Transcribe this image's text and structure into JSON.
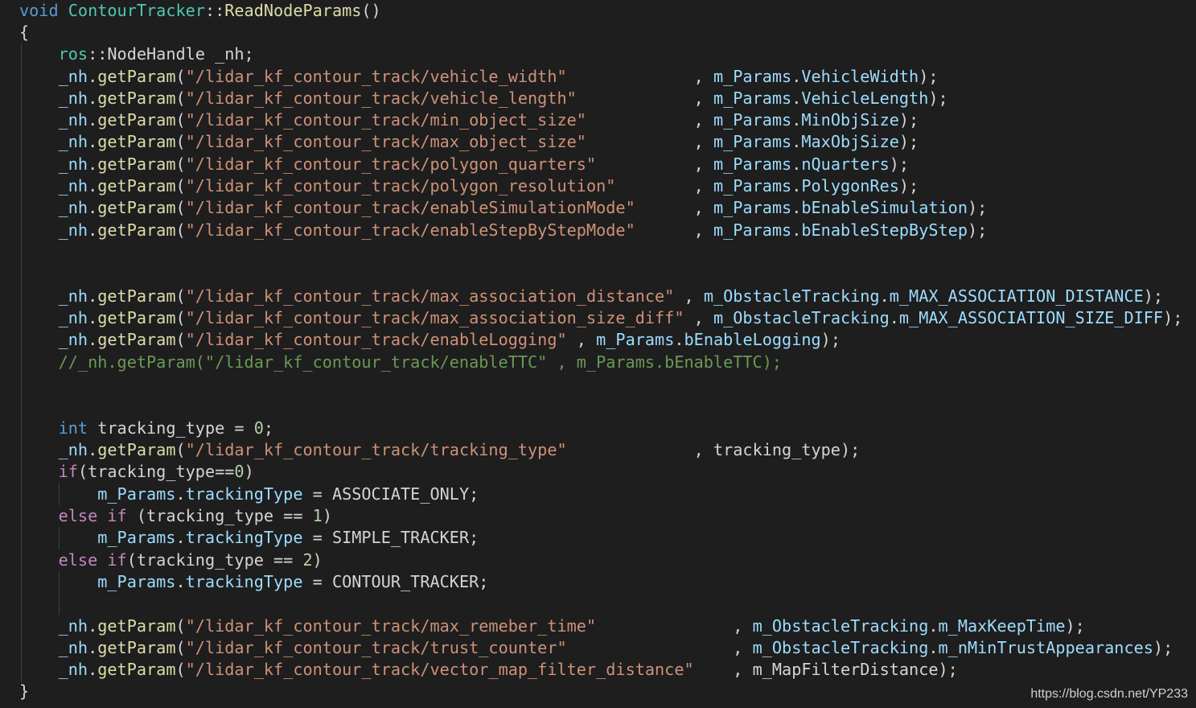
{
  "editor": {
    "theme_colors": {
      "background": "#1e1e1e",
      "keyword": "#569cd6",
      "control": "#c586c0",
      "type": "#4ec9b0",
      "function": "#dcdcaa",
      "string": "#ce9178",
      "variable": "#9cdcfe",
      "number": "#b5cea8",
      "comment": "#6a9955",
      "plain": "#d4d4d4"
    },
    "lines": [
      [
        [
          "kw",
          "void"
        ],
        [
          "plain",
          " "
        ],
        [
          "type",
          "ContourTracker"
        ],
        [
          "plain",
          "::"
        ],
        [
          "fn",
          "ReadNodeParams"
        ],
        [
          "plain",
          "()"
        ]
      ],
      [
        [
          "plain",
          "{"
        ]
      ],
      [
        [
          "plain",
          "    "
        ],
        [
          "type",
          "ros"
        ],
        [
          "plain",
          "::NodeHandle _nh;"
        ]
      ],
      [
        [
          "plain",
          "    "
        ],
        [
          "var",
          "_nh"
        ],
        [
          "plain",
          "."
        ],
        [
          "fn",
          "getParam"
        ],
        [
          "plain",
          "("
        ],
        [
          "str",
          "\"/lidar_kf_contour_track/vehicle_width\""
        ],
        [
          "plain",
          "             , "
        ],
        [
          "var",
          "m_Params"
        ],
        [
          "plain",
          "."
        ],
        [
          "var",
          "VehicleWidth"
        ],
        [
          "plain",
          ");"
        ]
      ],
      [
        [
          "plain",
          "    "
        ],
        [
          "var",
          "_nh"
        ],
        [
          "plain",
          "."
        ],
        [
          "fn",
          "getParam"
        ],
        [
          "plain",
          "("
        ],
        [
          "str",
          "\"/lidar_kf_contour_track/vehicle_length\""
        ],
        [
          "plain",
          "            , "
        ],
        [
          "var",
          "m_Params"
        ],
        [
          "plain",
          "."
        ],
        [
          "var",
          "VehicleLength"
        ],
        [
          "plain",
          ");"
        ]
      ],
      [
        [
          "plain",
          "    "
        ],
        [
          "var",
          "_nh"
        ],
        [
          "plain",
          "."
        ],
        [
          "fn",
          "getParam"
        ],
        [
          "plain",
          "("
        ],
        [
          "str",
          "\"/lidar_kf_contour_track/min_object_size\""
        ],
        [
          "plain",
          "           , "
        ],
        [
          "var",
          "m_Params"
        ],
        [
          "plain",
          "."
        ],
        [
          "var",
          "MinObjSize"
        ],
        [
          "plain",
          ");"
        ]
      ],
      [
        [
          "plain",
          "    "
        ],
        [
          "var",
          "_nh"
        ],
        [
          "plain",
          "."
        ],
        [
          "fn",
          "getParam"
        ],
        [
          "plain",
          "("
        ],
        [
          "str",
          "\"/lidar_kf_contour_track/max_object_size\""
        ],
        [
          "plain",
          "           , "
        ],
        [
          "var",
          "m_Params"
        ],
        [
          "plain",
          "."
        ],
        [
          "var",
          "MaxObjSize"
        ],
        [
          "plain",
          ");"
        ]
      ],
      [
        [
          "plain",
          "    "
        ],
        [
          "var",
          "_nh"
        ],
        [
          "plain",
          "."
        ],
        [
          "fn",
          "getParam"
        ],
        [
          "plain",
          "("
        ],
        [
          "str",
          "\"/lidar_kf_contour_track/polygon_quarters\""
        ],
        [
          "plain",
          "          , "
        ],
        [
          "var",
          "m_Params"
        ],
        [
          "plain",
          "."
        ],
        [
          "var",
          "nQuarters"
        ],
        [
          "plain",
          ");"
        ]
      ],
      [
        [
          "plain",
          "    "
        ],
        [
          "var",
          "_nh"
        ],
        [
          "plain",
          "."
        ],
        [
          "fn",
          "getParam"
        ],
        [
          "plain",
          "("
        ],
        [
          "str",
          "\"/lidar_kf_contour_track/polygon_resolution\""
        ],
        [
          "plain",
          "        , "
        ],
        [
          "var",
          "m_Params"
        ],
        [
          "plain",
          "."
        ],
        [
          "var",
          "PolygonRes"
        ],
        [
          "plain",
          ");"
        ]
      ],
      [
        [
          "plain",
          "    "
        ],
        [
          "var",
          "_nh"
        ],
        [
          "plain",
          "."
        ],
        [
          "fn",
          "getParam"
        ],
        [
          "plain",
          "("
        ],
        [
          "str",
          "\"/lidar_kf_contour_track/enableSimulationMode\""
        ],
        [
          "plain",
          "      , "
        ],
        [
          "var",
          "m_Params"
        ],
        [
          "plain",
          "."
        ],
        [
          "var",
          "bEnableSimulation"
        ],
        [
          "plain",
          ");"
        ]
      ],
      [
        [
          "plain",
          "    "
        ],
        [
          "var",
          "_nh"
        ],
        [
          "plain",
          "."
        ],
        [
          "fn",
          "getParam"
        ],
        [
          "plain",
          "("
        ],
        [
          "str",
          "\"/lidar_kf_contour_track/enableStepByStepMode\""
        ],
        [
          "plain",
          "      , "
        ],
        [
          "var",
          "m_Params"
        ],
        [
          "plain",
          "."
        ],
        [
          "var",
          "bEnableStepByStep"
        ],
        [
          "plain",
          ");"
        ]
      ],
      [],
      [],
      [
        [
          "plain",
          "    "
        ],
        [
          "var",
          "_nh"
        ],
        [
          "plain",
          "."
        ],
        [
          "fn",
          "getParam"
        ],
        [
          "plain",
          "("
        ],
        [
          "str",
          "\"/lidar_kf_contour_track/max_association_distance\""
        ],
        [
          "plain",
          " , "
        ],
        [
          "var",
          "m_ObstacleTracking"
        ],
        [
          "plain",
          "."
        ],
        [
          "var",
          "m_MAX_ASSOCIATION_DISTANCE"
        ],
        [
          "plain",
          ");"
        ]
      ],
      [
        [
          "plain",
          "    "
        ],
        [
          "var",
          "_nh"
        ],
        [
          "plain",
          "."
        ],
        [
          "fn",
          "getParam"
        ],
        [
          "plain",
          "("
        ],
        [
          "str",
          "\"/lidar_kf_contour_track/max_association_size_diff\""
        ],
        [
          "plain",
          " , "
        ],
        [
          "var",
          "m_ObstacleTracking"
        ],
        [
          "plain",
          "."
        ],
        [
          "var",
          "m_MAX_ASSOCIATION_SIZE_DIFF"
        ],
        [
          "plain",
          ");"
        ]
      ],
      [
        [
          "plain",
          "    "
        ],
        [
          "var",
          "_nh"
        ],
        [
          "plain",
          "."
        ],
        [
          "fn",
          "getParam"
        ],
        [
          "plain",
          "("
        ],
        [
          "str",
          "\"/lidar_kf_contour_track/enableLogging\""
        ],
        [
          "plain",
          " , "
        ],
        [
          "var",
          "m_Params"
        ],
        [
          "plain",
          "."
        ],
        [
          "var",
          "bEnableLogging"
        ],
        [
          "plain",
          ");"
        ]
      ],
      [
        [
          "plain",
          "    "
        ],
        [
          "cmt",
          "//_nh.getParam(\"/lidar_kf_contour_track/enableTTC\" , m_Params.bEnableTTC);"
        ]
      ],
      [],
      [],
      [
        [
          "plain",
          "    "
        ],
        [
          "kw",
          "int"
        ],
        [
          "plain",
          " tracking_type = "
        ],
        [
          "num",
          "0"
        ],
        [
          "plain",
          ";"
        ]
      ],
      [
        [
          "plain",
          "    "
        ],
        [
          "var",
          "_nh"
        ],
        [
          "plain",
          "."
        ],
        [
          "fn",
          "getParam"
        ],
        [
          "plain",
          "("
        ],
        [
          "str",
          "\"/lidar_kf_contour_track/tracking_type\""
        ],
        [
          "plain",
          "             , tracking_type);"
        ]
      ],
      [
        [
          "plain",
          "    "
        ],
        [
          "ctl",
          "if"
        ],
        [
          "plain",
          "(tracking_type=="
        ],
        [
          "num",
          "0"
        ],
        [
          "plain",
          ")"
        ]
      ],
      [
        [
          "plain",
          "        "
        ],
        [
          "var",
          "m_Params"
        ],
        [
          "plain",
          "."
        ],
        [
          "var",
          "trackingType"
        ],
        [
          "plain",
          " = ASSOCIATE_ONLY;"
        ]
      ],
      [
        [
          "plain",
          "    "
        ],
        [
          "ctl",
          "else"
        ],
        [
          "plain",
          " "
        ],
        [
          "ctl",
          "if"
        ],
        [
          "plain",
          " (tracking_type == "
        ],
        [
          "num",
          "1"
        ],
        [
          "plain",
          ")"
        ]
      ],
      [
        [
          "plain",
          "        "
        ],
        [
          "var",
          "m_Params"
        ],
        [
          "plain",
          "."
        ],
        [
          "var",
          "trackingType"
        ],
        [
          "plain",
          " = SIMPLE_TRACKER;"
        ]
      ],
      [
        [
          "plain",
          "    "
        ],
        [
          "ctl",
          "else"
        ],
        [
          "plain",
          " "
        ],
        [
          "ctl",
          "if"
        ],
        [
          "plain",
          "(tracking_type == "
        ],
        [
          "num",
          "2"
        ],
        [
          "plain",
          ")"
        ]
      ],
      [
        [
          "plain",
          "        "
        ],
        [
          "var",
          "m_Params"
        ],
        [
          "plain",
          "."
        ],
        [
          "var",
          "trackingType"
        ],
        [
          "plain",
          " = CONTOUR_TRACKER;"
        ]
      ],
      [],
      [
        [
          "plain",
          "    "
        ],
        [
          "var",
          "_nh"
        ],
        [
          "plain",
          "."
        ],
        [
          "fn",
          "getParam"
        ],
        [
          "plain",
          "("
        ],
        [
          "str",
          "\"/lidar_kf_contour_track/max_remeber_time\""
        ],
        [
          "plain",
          "              , "
        ],
        [
          "var",
          "m_ObstacleTracking"
        ],
        [
          "plain",
          "."
        ],
        [
          "var",
          "m_MaxKeepTime"
        ],
        [
          "plain",
          ");"
        ]
      ],
      [
        [
          "plain",
          "    "
        ],
        [
          "var",
          "_nh"
        ],
        [
          "plain",
          "."
        ],
        [
          "fn",
          "getParam"
        ],
        [
          "plain",
          "("
        ],
        [
          "str",
          "\"/lidar_kf_contour_track/trust_counter\""
        ],
        [
          "plain",
          "                 , "
        ],
        [
          "var",
          "m_ObstacleTracking"
        ],
        [
          "plain",
          "."
        ],
        [
          "var",
          "m_nMinTrustAppearances"
        ],
        [
          "plain",
          ");"
        ]
      ],
      [
        [
          "plain",
          "    "
        ],
        [
          "var",
          "_nh"
        ],
        [
          "plain",
          "."
        ],
        [
          "fn",
          "getParam"
        ],
        [
          "plain",
          "("
        ],
        [
          "str",
          "\"/lidar_kf_contour_track/vector_map_filter_distance\""
        ],
        [
          "plain",
          "    , m_MapFilterDistance);"
        ]
      ],
      [
        [
          "plain",
          "}"
        ]
      ]
    ]
  },
  "watermark": "https://blog.csdn.net/YP233"
}
